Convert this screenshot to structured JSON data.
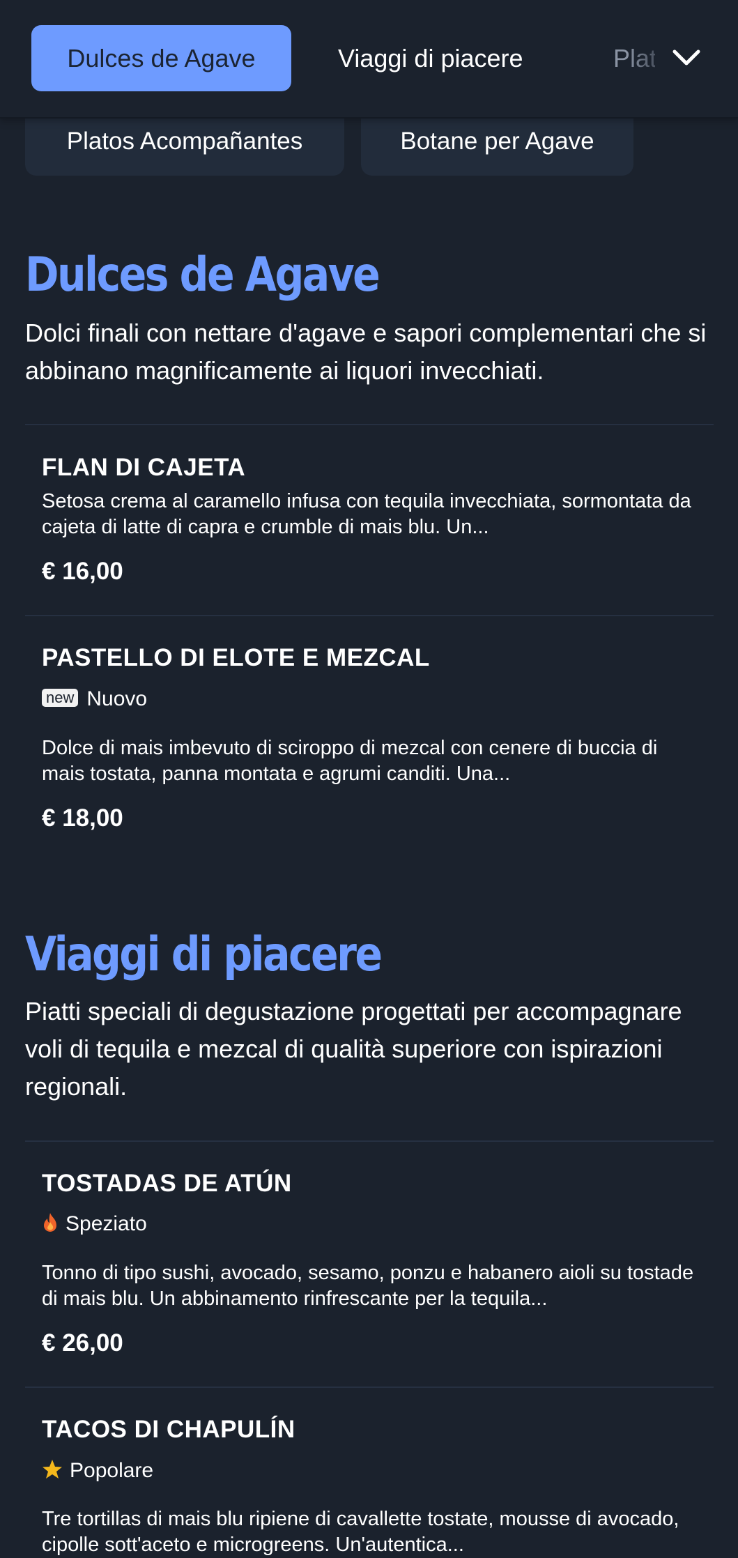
{
  "nav": {
    "tabs": [
      {
        "label": "Dulces de Agave",
        "active": true
      },
      {
        "label": "Viaggi di piacere",
        "active": false
      },
      {
        "label": "Platos Acompañantes",
        "active": false
      }
    ],
    "more_icon": "chevron-down-icon",
    "chips": [
      {
        "label": "Platos Acompañantes"
      },
      {
        "label": "Botane per Agave"
      }
    ]
  },
  "sections": [
    {
      "title": "Dulces de Agave",
      "description": "Dolci finali con nettare d'agave e sapori complementari che si abbinano magnificamente ai liquori invecchiati.",
      "items": [
        {
          "name": "FLAN DI CAJETA",
          "description": "Setosa crema al caramello infusa con tequila invecchiata, sormontata da cajeta di latte di capra e crumble di mais blu. Un...",
          "price": "€ 16,00"
        },
        {
          "name": "PASTELLO DI ELOTE E MEZCAL",
          "tag": {
            "badge": "new",
            "label": "Nuovo"
          },
          "description": "Dolce di mais imbevuto di sciroppo di mezcal con cenere di buccia di mais tostata, panna montata e agrumi canditi. Una...",
          "price": "€ 18,00"
        }
      ]
    },
    {
      "title": "Viaggi di piacere",
      "description": "Piatti speciali di degustazione progettati per accompagnare voli di tequila e mezcal di qualità superiore con ispirazioni regionali.",
      "items": [
        {
          "name": "TOSTADAS DE ATÚN",
          "tag": {
            "icon": "flame-icon",
            "label": "Speziato",
            "color": "#f0642a"
          },
          "description": "Tonno di tipo sushi, avocado, sesamo, ponzu e habanero aioli su tostade di mais blu. Un abbinamento rinfrescante per la tequila...",
          "price": "€ 26,00"
        },
        {
          "name": "TACOS DI CHAPULÍN",
          "tag": {
            "icon": "star-icon",
            "label": "Popolare",
            "color": "#f5b81c"
          },
          "description": "Tre tortillas di mais blu ripiene di cavallette tostate, mousse di avocado, cipolle sott'aceto e microgreens. Un'autentica..."
        }
      ]
    }
  ],
  "colors": {
    "background": "#1b222d",
    "accent": "#6e9bff",
    "chip_bg": "#222c3b"
  }
}
